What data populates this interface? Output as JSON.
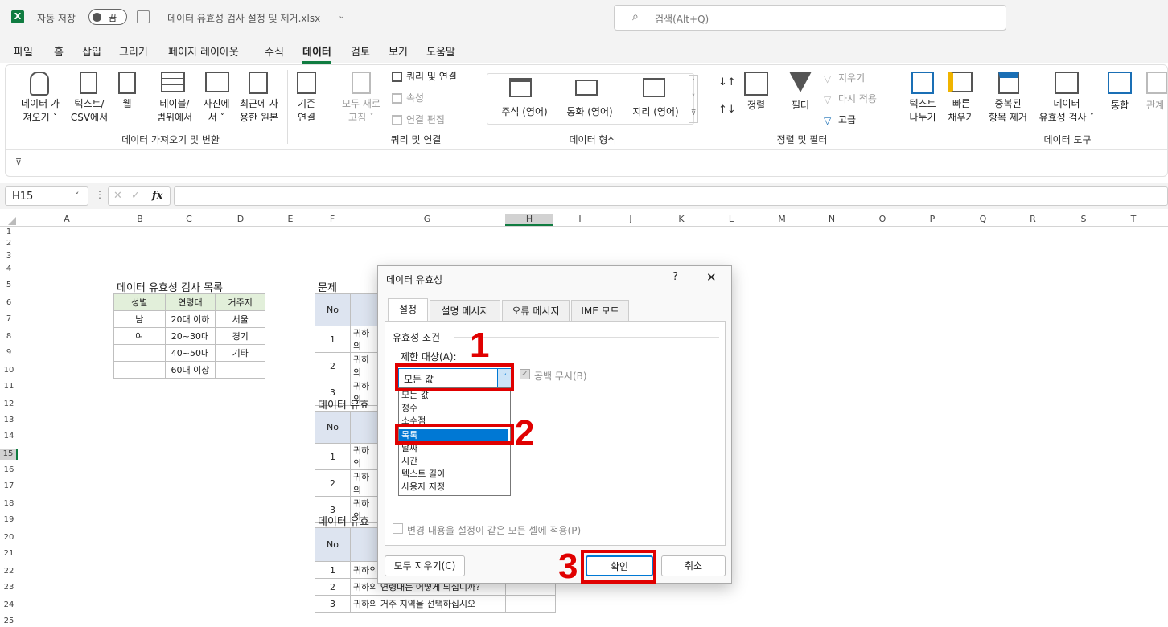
{
  "title": {
    "autosave": "자동 저장",
    "toggle": "끔",
    "filename": "데이터 유효성 검사 설정 및 제거.xlsx",
    "search": "검색(Alt+Q)"
  },
  "menu": [
    "파일",
    "홈",
    "삽입",
    "그리기",
    "페이지 레이아웃",
    "수식",
    "데이터",
    "검토",
    "보기",
    "도움말"
  ],
  "ribbon": {
    "get_data": "데이터 가\n져오기 ˅",
    "text_csv": "텍스트/\nCSV에서",
    "web": "웹",
    "table_range": "테이블/\n범위에서",
    "picture": "사진에\n서 ˅",
    "recent": "최근에 사\n용한 원본",
    "existing": "기존\n연결",
    "group1": "데이터 가져오기 및 변환",
    "refresh": "모두 새로\n고침 ˅",
    "queries": "쿼리 및 연결",
    "properties": "속성",
    "edit_links": "연결 편집",
    "group2": "쿼리 및 연결",
    "stocks": "주식 (영어)",
    "currency": "통화 (영어)",
    "geo": "지리 (영어)",
    "group3": "데이터 형식",
    "sort": "정렬",
    "filter": "필터",
    "clear": "지우기",
    "reapply": "다시 적용",
    "advanced": "고급",
    "group4": "정렬 및 필터",
    "text_to_col": "텍스트\n나누기",
    "flash_fill": "빠른\n채우기",
    "remove_dup": "중복된\n항목 제거",
    "validation": "데이터\n유효성 검사 ˅",
    "consolidate": "통합",
    "relations": "관계",
    "group5": "데이터 도구"
  },
  "formula": {
    "cell": "H15",
    "fx": "fx"
  },
  "columns": [
    "A",
    "B",
    "C",
    "D",
    "E",
    "F",
    "G",
    "H",
    "I",
    "J",
    "K",
    "L",
    "M",
    "N",
    "O",
    "P",
    "Q",
    "R",
    "S",
    "T"
  ],
  "rows": [
    "1",
    "2",
    "3",
    "4",
    "5",
    "6",
    "7",
    "8",
    "9",
    "10",
    "11",
    "12",
    "13",
    "14",
    "15",
    "16",
    "17",
    "18",
    "19",
    "20",
    "21",
    "22",
    "23",
    "24",
    "25"
  ],
  "sheet": {
    "list_title": "데이터 유효성 검사 목록",
    "headers": [
      "성별",
      "연령대",
      "거주지"
    ],
    "rows": [
      [
        "남",
        "20대 이하",
        "서울"
      ],
      [
        "여",
        "20~30대",
        "경기"
      ],
      [
        "",
        "40~50대",
        "기타"
      ],
      [
        "",
        "60대 이상",
        ""
      ]
    ],
    "q_title": "문제",
    "q2_title": "데이터 유효",
    "q3_title": "데이터 유효",
    "no": "No",
    "q_rows": [
      [
        "1",
        "귀하의"
      ],
      [
        "2",
        "귀하의"
      ],
      [
        "3",
        "귀하의"
      ]
    ],
    "q3_rows": [
      [
        "1",
        "귀하의"
      ],
      [
        "2",
        "귀하의 연령대는 어떻게 되십니까?"
      ],
      [
        "3",
        "귀하의 거주 지역을 선택하십시오"
      ]
    ]
  },
  "dialog": {
    "title": "데이터 유효성",
    "help": "?",
    "close": "✕",
    "tabs": [
      "설정",
      "설명 메시지",
      "오류 메시지",
      "IME 모드"
    ],
    "criteria": "유효성 조건",
    "allow_label": "제한 대상(A):",
    "selected": "모든 값",
    "ignore_blank": "공백 무시(B)",
    "options": [
      "모든 값",
      "정수",
      "소수점",
      "목록",
      "날짜",
      "시간",
      "텍스트 길이",
      "사용자 지정"
    ],
    "apply_all": "변경 내용을 설정이 같은 모든 셀에 적용(P)",
    "clear_all": "모두 지우기(C)",
    "ok": "확인",
    "cancel": "취소"
  },
  "annotations": [
    "1",
    "2",
    "3"
  ]
}
